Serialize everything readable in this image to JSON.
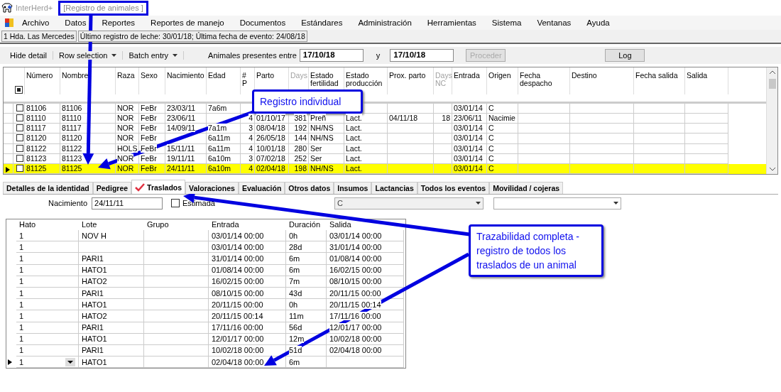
{
  "window": {
    "app": "InterHerd+",
    "title": "[Registro de animales ]"
  },
  "menu": [
    "Archivo",
    "Datos",
    "Reportes",
    "Reportes de manejo",
    "Documentos",
    "Estándares",
    "Administración",
    "Herramientas",
    "Sistema",
    "Ventanas",
    "Ayuda"
  ],
  "status": [
    "1 Hda. Las Mercedes",
    "Último registro de leche: 30/01/18; Última fecha de evento: 24/08/18"
  ],
  "toolbar": {
    "buttons": [
      {
        "label": "Hide detail",
        "dropdown": false
      },
      {
        "label": "Row selection",
        "dropdown": true
      },
      {
        "label": "Batch entry",
        "dropdown": true
      }
    ],
    "range_label": "Animales presentes entre",
    "from": "17/10/18",
    "and": "y",
    "to": "17/10/18",
    "proceed": {
      "label": "Proceder",
      "disabled": true
    },
    "log": {
      "label": "Log",
      "disabled": false
    }
  },
  "grid": {
    "select_all": {
      "checked": true
    },
    "columns": [
      {
        "label": "Número",
        "faded": false
      },
      {
        "label": "Nombre",
        "faded": false
      },
      {
        "label": "Raza",
        "faded": false
      },
      {
        "label": "Sexo",
        "faded": false
      },
      {
        "label": "Nacimiento",
        "faded": false
      },
      {
        "label": "Edad",
        "faded": false
      },
      {
        "label": "# P",
        "faded": false
      },
      {
        "label": "Parto",
        "faded": false
      },
      {
        "label": "Days",
        "faded": true
      },
      {
        "label": "Estado fertilidad",
        "faded": false
      },
      {
        "label": "Estado producción",
        "faded": false
      },
      {
        "label": "Prox. parto",
        "faded": false
      },
      {
        "label": "Days NC",
        "faded": true
      },
      {
        "label": "Entrada",
        "faded": false
      },
      {
        "label": "Origen",
        "faded": false
      },
      {
        "label": "Fecha despacho",
        "faded": false
      },
      {
        "label": "Destino",
        "faded": false
      },
      {
        "label": "Fecha salida",
        "faded": false
      },
      {
        "label": "Salida",
        "faded": false
      }
    ],
    "rows": [
      {
        "selected": false,
        "checked": false,
        "cells": [
          "81106",
          "81106",
          "NOR",
          "FeBr",
          "23/03/11",
          "7a6m",
          "",
          "",
          "",
          "",
          "",
          "",
          "",
          "03/01/14",
          "C"
        ]
      },
      {
        "selected": false,
        "checked": false,
        "cells": [
          "81110",
          "81110",
          "NOR",
          "FeBr",
          "23/06/11",
          "",
          "4",
          "01/10/17",
          "381",
          "Preñ",
          "Lact.",
          "04/11/18",
          "18",
          "23/06/11",
          "Nacimie"
        ]
      },
      {
        "selected": false,
        "checked": false,
        "cells": [
          "81117",
          "81117",
          "NOR",
          "FeBr",
          "14/09/11",
          "7a1m",
          "3",
          "08/04/18",
          "192",
          "NH/NS",
          "Lact.",
          "",
          "",
          "03/01/14",
          "C"
        ]
      },
      {
        "selected": false,
        "checked": false,
        "cells": [
          "81120",
          "81120",
          "NOR",
          "FeBr",
          "",
          "6a11m",
          "4",
          "26/05/18",
          "144",
          "NH/NS",
          "Lact.",
          "",
          "",
          "03/01/14",
          "C"
        ]
      },
      {
        "selected": false,
        "checked": false,
        "cells": [
          "81122",
          "81122",
          "HOLS",
          "FeBr",
          "15/11/11",
          "6a11m",
          "4",
          "10/01/18",
          "280",
          "Ser",
          "Lact.",
          "",
          "",
          "03/01/14",
          "C"
        ]
      },
      {
        "selected": false,
        "checked": false,
        "cells": [
          "81123",
          "81123",
          "NOR",
          "FeBr",
          "19/11/11",
          "6a10m",
          "3",
          "07/02/18",
          "252",
          "Ser",
          "Lact.",
          "",
          "",
          "03/01/14",
          "C"
        ]
      },
      {
        "selected": true,
        "checked": false,
        "cells": [
          "81125",
          "81125",
          "NOR",
          "FeBr",
          "24/11/11",
          "6a10m",
          "4",
          "02/04/18",
          "198",
          "NH/NS",
          "Lact.",
          "",
          "",
          "03/01/14",
          "C"
        ]
      }
    ]
  },
  "tabs": [
    {
      "label": "Detalles de la identidad",
      "selected": false
    },
    {
      "label": "Pedigree",
      "selected": false
    },
    {
      "label": "Traslados",
      "selected": true
    },
    {
      "label": "Valoraciones",
      "selected": false
    },
    {
      "label": "Evaluación",
      "selected": false
    },
    {
      "label": "Otros datos",
      "selected": false
    },
    {
      "label": "Insumos",
      "selected": false
    },
    {
      "label": "Lactancias",
      "selected": false
    },
    {
      "label": "Todos los eventos",
      "selected": false
    },
    {
      "label": "Movilidad / cojeras",
      "selected": false
    }
  ],
  "form": {
    "birth_label": "Nacimiento",
    "birth": "24/11/11",
    "estimated": {
      "label": "Estimada",
      "checked": false
    },
    "origin": {
      "value": "C",
      "disabled": true
    }
  },
  "moves": {
    "columns": [
      "Hato",
      "Lote",
      "Grupo",
      "Entrada",
      "Duración",
      "Salida"
    ],
    "rows": [
      {
        "current": false,
        "cells": [
          "1",
          "NOV H",
          "",
          "03/01/14 00:00",
          "0h",
          "03/01/14 00:00"
        ]
      },
      {
        "current": false,
        "cells": [
          "1",
          "",
          "",
          "03/01/14 00:00",
          "28d",
          "31/01/14 00:00"
        ]
      },
      {
        "current": false,
        "cells": [
          "1",
          "PARI1",
          "",
          "31/01/14 00:00",
          "6m",
          "01/08/14 00:00"
        ]
      },
      {
        "current": false,
        "cells": [
          "1",
          "HATO1",
          "",
          "01/08/14 00:00",
          "6m",
          "16/02/15 00:00"
        ]
      },
      {
        "current": false,
        "cells": [
          "1",
          "HATO2",
          "",
          "16/02/15 00:00",
          "7m",
          "08/10/15 00:00"
        ]
      },
      {
        "current": false,
        "cells": [
          "1",
          "PARI1",
          "",
          "08/10/15 00:00",
          "43d",
          "20/11/15 00:00"
        ]
      },
      {
        "current": false,
        "cells": [
          "1",
          "HATO1",
          "",
          "20/11/15 00:00",
          "0h",
          "20/11/15 00:14"
        ]
      },
      {
        "current": false,
        "cells": [
          "1",
          "HATO2",
          "",
          "20/11/15 00:14",
          "11m",
          "17/11/16 00:00"
        ]
      },
      {
        "current": false,
        "cells": [
          "1",
          "PARI1",
          "",
          "17/11/16 00:00",
          "56d",
          "12/01/17 00:00"
        ]
      },
      {
        "current": false,
        "cells": [
          "1",
          "HATO1",
          "",
          "12/01/17 00:00",
          "12m",
          "10/02/18 00:00"
        ]
      },
      {
        "current": false,
        "cells": [
          "1",
          "PARI1",
          "",
          "10/02/18 00:00",
          "51d",
          "02/04/18 00:00"
        ]
      },
      {
        "current": true,
        "cells": [
          "1",
          "HATO1",
          "",
          "02/04/18 00:00",
          "6m",
          ""
        ]
      }
    ]
  },
  "annotations": [
    "Registro individual",
    "Trazabilidad completa - registro de todos los traslados de un animal"
  ]
}
